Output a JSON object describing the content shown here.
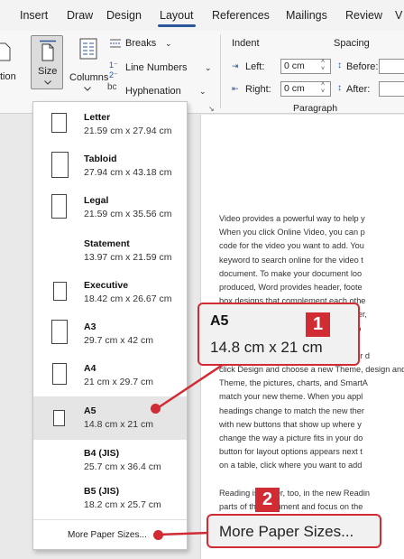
{
  "ribbon_tabs": [
    "Insert",
    "Draw",
    "Design",
    "Layout",
    "References",
    "Mailings",
    "Review",
    "V"
  ],
  "ribbon": {
    "orientation_partial": "tion",
    "size_label": "Size",
    "columns_label": "Columns",
    "breaks_label": "Breaks",
    "line_numbers_label": "Line Numbers",
    "hyphenation_label": "Hyphenation",
    "indent_header": "Indent",
    "spacing_header": "Spacing",
    "left_label": "Left:",
    "right_label": "Right:",
    "left_value": "0 cm",
    "right_value": "0 cm",
    "before_label": "Before:",
    "after_label": "After:",
    "paragraph_group": "Paragraph",
    "accent_color": "#2b579a"
  },
  "paper_sizes": [
    {
      "name": "Letter",
      "dims": "21.59 cm x 27.94 cm"
    },
    {
      "name": "Tabloid",
      "dims": "27.94 cm x 43.18 cm"
    },
    {
      "name": "Legal",
      "dims": "21.59 cm x 35.56 cm"
    },
    {
      "name": "Statement",
      "dims": "13.97 cm x 21.59 cm"
    },
    {
      "name": "Executive",
      "dims": "18.42 cm x 26.67 cm"
    },
    {
      "name": "A3",
      "dims": "29.7 cm x 42 cm"
    },
    {
      "name": "A4",
      "dims": "21 cm x 29.7 cm"
    },
    {
      "name": "A5",
      "dims": "14.8 cm x 21 cm"
    },
    {
      "name": "B4 (JIS)",
      "dims": "25.7 cm x 36.4 cm"
    },
    {
      "name": "B5 (JIS)",
      "dims": "18.2 cm x 25.7 cm"
    }
  ],
  "selected_paper": "A5",
  "more_paper_sizes": "More Paper Sizes...",
  "callout1": {
    "number": "1",
    "title": "A5",
    "dims": "14.8 cm x 21 cm"
  },
  "callout2": {
    "number": "2",
    "text": "More Paper Sizes..."
  },
  "document_lines": [
    "Video provides a powerful way to help y",
    "When you click Online Video, you can p",
    "code for the video you want to add. You",
    "keyword to search online for the video t",
    "document. To make your document loo",
    "produced, Word provides header, foote",
    "box designs that complement each othe",
    "can add a matching cover page, header,",
    "want and then choose the elements yo",
    "",
    "Themes and styles also help keep your d",
    "click Design and choose a new Theme, design and",
    "Theme, the pictures, charts, and SmartA",
    "match your new theme. When you appl",
    "headings change to match the new ther",
    "with new buttons that show up where y",
    "change the way a picture fits in your do",
    "button for layout options appears next t",
    "on a table, click where you want to add",
    "",
    "Reading is easier, too, in the new Readin",
    "parts of the document and focus on the"
  ],
  "colors": {
    "callout_red": "#d12b34",
    "selected_bg": "#e5e5e5"
  }
}
